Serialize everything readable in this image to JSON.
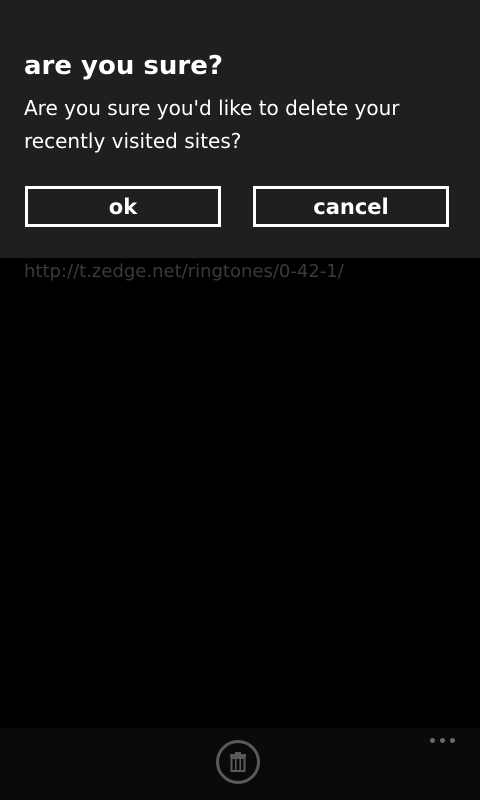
{
  "page": {
    "url_text": "http://t.zedge.net/ringtones/0-42-1/"
  },
  "dialog": {
    "title": "are you sure?",
    "message": "Are you sure you'd like to delete your recently visited sites?",
    "ok_label": "ok",
    "cancel_label": "cancel"
  },
  "appbar": {
    "delete_icon": "trash-icon",
    "more_icon": "ellipsis-icon"
  },
  "colors": {
    "dialog_bg": "#1f1f1f",
    "appbar_bg": "#0a0a0a",
    "url_text": "#3a3a3a"
  }
}
